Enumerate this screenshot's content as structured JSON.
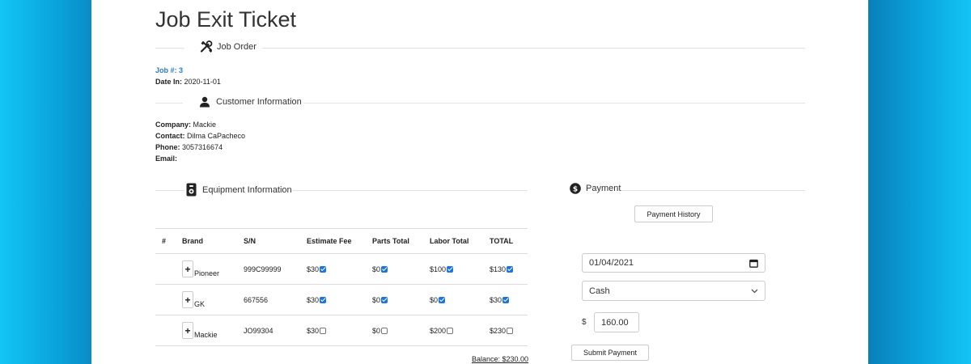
{
  "page": {
    "title": "Job Exit Ticket"
  },
  "job_order": {
    "heading": "Job Order",
    "job_label": "Job #:",
    "job_number": "3",
    "date_in_label": "Date In:",
    "date_in": "2020-11-01"
  },
  "customer": {
    "heading": "Customer Information",
    "company_label": "Company:",
    "company": "Mackie",
    "contact_label": "Contact:",
    "contact": "Dilma CaPacheco",
    "phone_label": "Phone:",
    "phone": "3057316674",
    "email_label": "Email:",
    "email": ""
  },
  "equipment": {
    "heading": "Equipment Information",
    "columns": [
      "#",
      "Brand",
      "S/N",
      "Estimate Fee",
      "Parts Total",
      "Labor Total",
      "TOTAL"
    ],
    "rows": [
      {
        "num": "",
        "brand": "Pioneer",
        "sn": "999C99999",
        "estimate": "$30",
        "estimate_checked": true,
        "parts": "$0",
        "parts_checked": true,
        "labor": "$100",
        "labor_checked": true,
        "total": "$130",
        "total_checked": true
      },
      {
        "num": "",
        "brand": "GK",
        "sn": "667556",
        "estimate": "$30",
        "estimate_checked": true,
        "parts": "$0",
        "parts_checked": true,
        "labor": "$0",
        "labor_checked": true,
        "total": "$30",
        "total_checked": true
      },
      {
        "num": "",
        "brand": "Mackie",
        "sn": "JO99304",
        "estimate": "$30",
        "estimate_checked": false,
        "parts": "$0",
        "parts_checked": false,
        "labor": "$200",
        "labor_checked": false,
        "total": "$230",
        "total_checked": false
      }
    ],
    "balance": "Balance: $230.00"
  },
  "payment": {
    "heading": "Payment",
    "history_button": "Payment History",
    "date_value": "01/04/2021",
    "method_value": "Cash",
    "currency_symbol": "$",
    "amount_value": "160.00",
    "submit_button": "Submit Payment"
  },
  "icons": {
    "job_order": "tools-icon",
    "customer": "user-icon",
    "equipment": "speaker-icon",
    "payment": "dollar-circle-icon",
    "calendar": "calendar-icon",
    "dropdown": "chevron-down-icon"
  }
}
